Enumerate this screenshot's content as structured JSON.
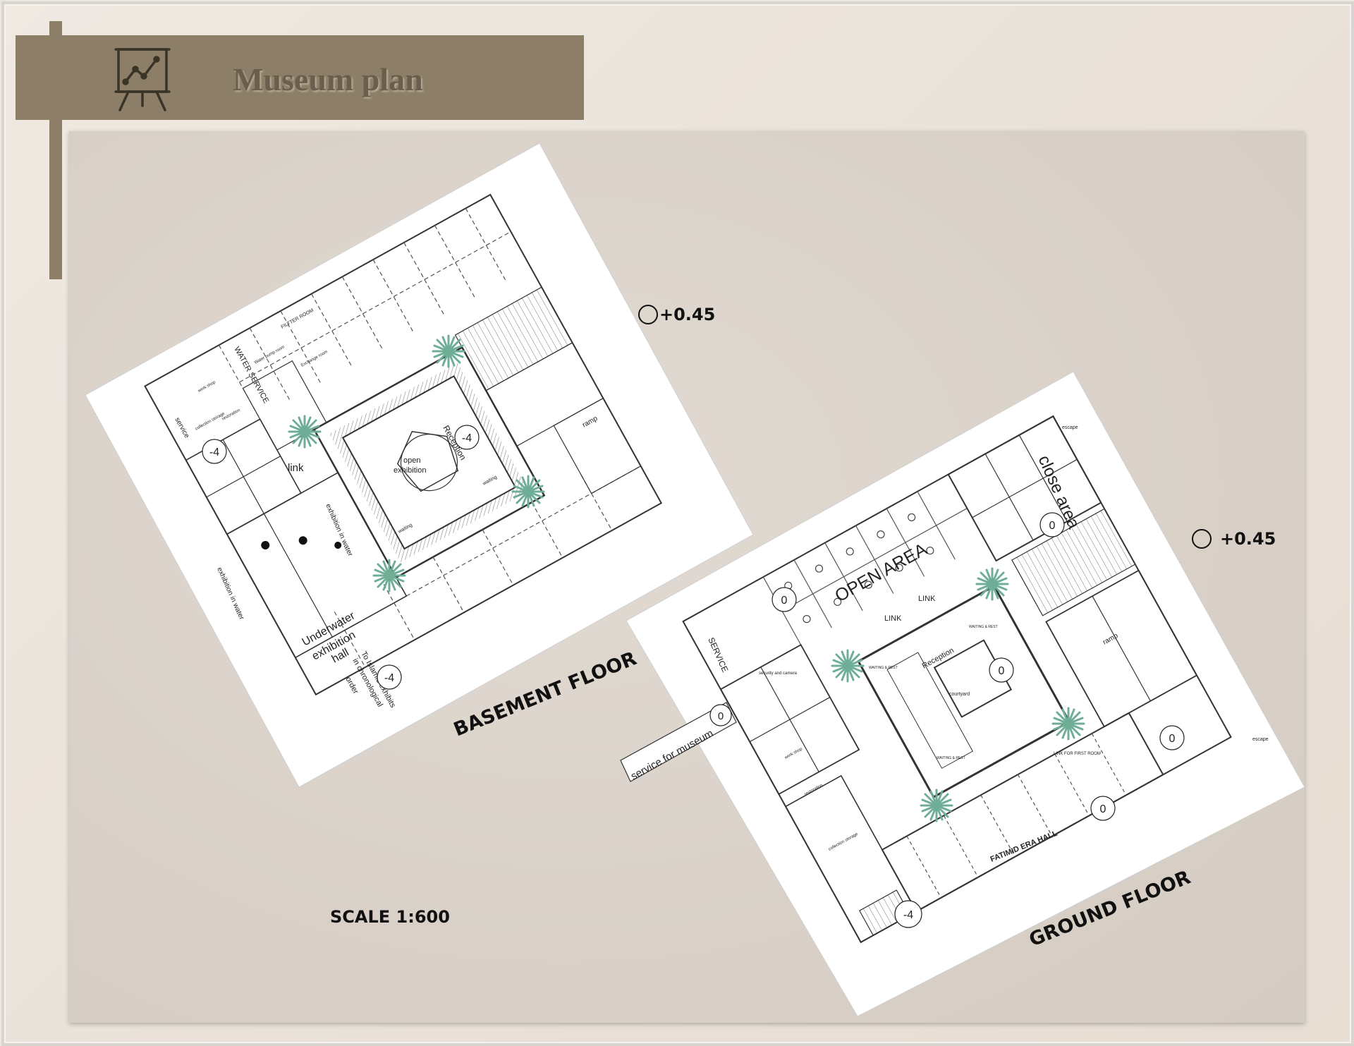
{
  "header": {
    "title": "Museum plan",
    "icon": "presentation-chart-icon"
  },
  "scale_label": "SCALE 1:600",
  "basement": {
    "floor_label": "BASEMENT FLOOR",
    "level_label": "+0.45",
    "rooms": {
      "filter_room": "FILTTER ROOM",
      "water_service": "WATER SERVICE",
      "water_pump_room": "Water pump room",
      "exchange_room": "Exchange room",
      "work_shop": "work shop",
      "restoration": "restoration",
      "collection_storage": "collection storage",
      "service": "service",
      "link": "link",
      "exhibition_in_water_1": "exhibition in water",
      "exhibition_in_water_2": "exhibition in water",
      "underwater_hall_1": "Underwater",
      "underwater_hall_2": "exhibition",
      "underwater_hall_3": "hall",
      "reception": "Reception",
      "open_exhibition_1": "open",
      "open_exhibition_2": "exhibition",
      "waiting_1": "waiting",
      "waiting_2": "waiting",
      "ramp": "ramp",
      "to_islamic_1": "To Islamic exhibits",
      "to_islamic_2": "in chronological",
      "to_islamic_3": "order"
    },
    "levels": {
      "a": "-4",
      "b": "-4",
      "c": "-4"
    }
  },
  "ground": {
    "floor_label": "GROUND FLOOR",
    "level_label": "+0.45",
    "rooms": {
      "open_area": "OPEN AREA",
      "close_area": "close area",
      "link_1": "LINK",
      "link_2": "LINK",
      "reception": "Reception",
      "courtyard": "courtyard",
      "waiting_rest_1": "WAITING & REST",
      "waiting_rest_2": "WAITING & REST",
      "waiting_rest_3": "WAITING & REST",
      "service": "SERVICE",
      "security": "security and camera",
      "work_shop": "work shop",
      "restoration": "restoration",
      "collection_storage": "collection storage",
      "fatimid_hall": "FATIMID ERA HALL",
      "link_first_room": "LINK FOR FIRST ROOM",
      "ramp": "ramp",
      "escape_1": "escape",
      "escape_2": "escape",
      "service_for_museum": "service for museum"
    },
    "levels": {
      "a": "0",
      "b": "0",
      "c": "0",
      "d": "0",
      "e": "0",
      "f": "0",
      "g": "-4"
    }
  }
}
